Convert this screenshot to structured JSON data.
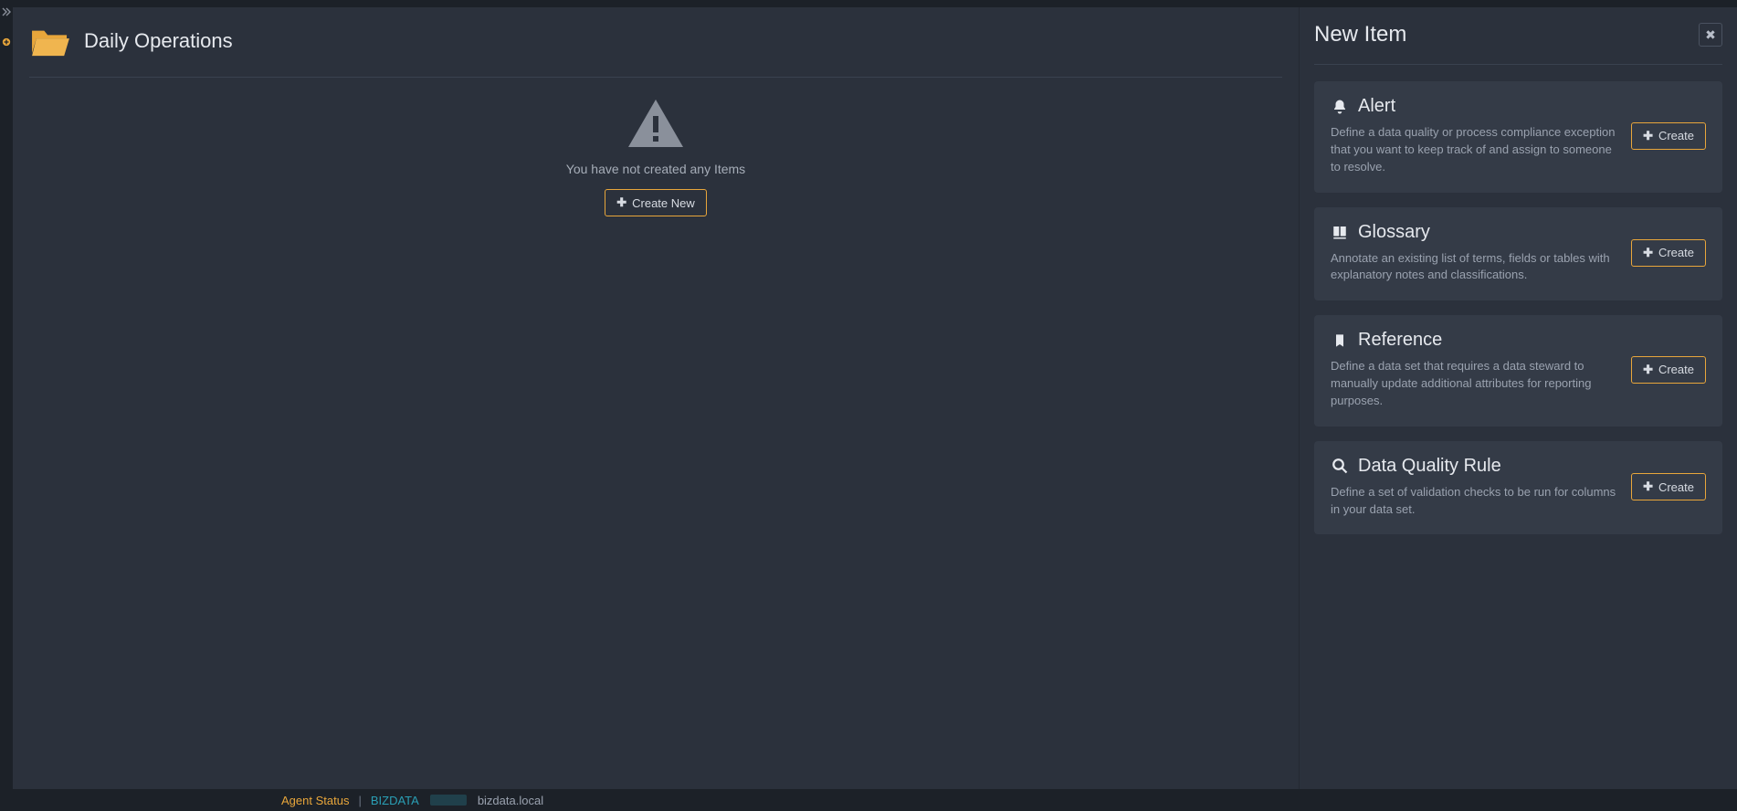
{
  "main": {
    "title": "Daily Operations",
    "empty_message": "You have not created any Items",
    "create_button": "Create New"
  },
  "panel": {
    "title": "New Item",
    "cards": [
      {
        "icon": "bell-icon",
        "title": "Alert",
        "desc": "Define a data quality or process compliance exception that you want to keep track of and assign to someone to resolve.",
        "btn": "Create"
      },
      {
        "icon": "book-icon",
        "title": "Glossary",
        "desc": "Annotate an existing list of terms, fields or tables with explanatory notes and classifications.",
        "btn": "Create"
      },
      {
        "icon": "bookmark-icon",
        "title": "Reference",
        "desc": "Define a data set that requires a data steward to manually update additional attributes for reporting purposes.",
        "btn": "Create"
      },
      {
        "icon": "search-icon",
        "title": "Data Quality Rule",
        "desc": "Define a set of validation checks to be run for columns in your data set.",
        "btn": "Create"
      }
    ]
  },
  "statusbar": {
    "agent_label": "Agent Status",
    "separator": "|",
    "host": "BIZDATA",
    "domain": "bizdata.local"
  },
  "colors": {
    "accent": "#e8a63b",
    "panel_card": "#343b47",
    "bg": "#2b313c"
  }
}
